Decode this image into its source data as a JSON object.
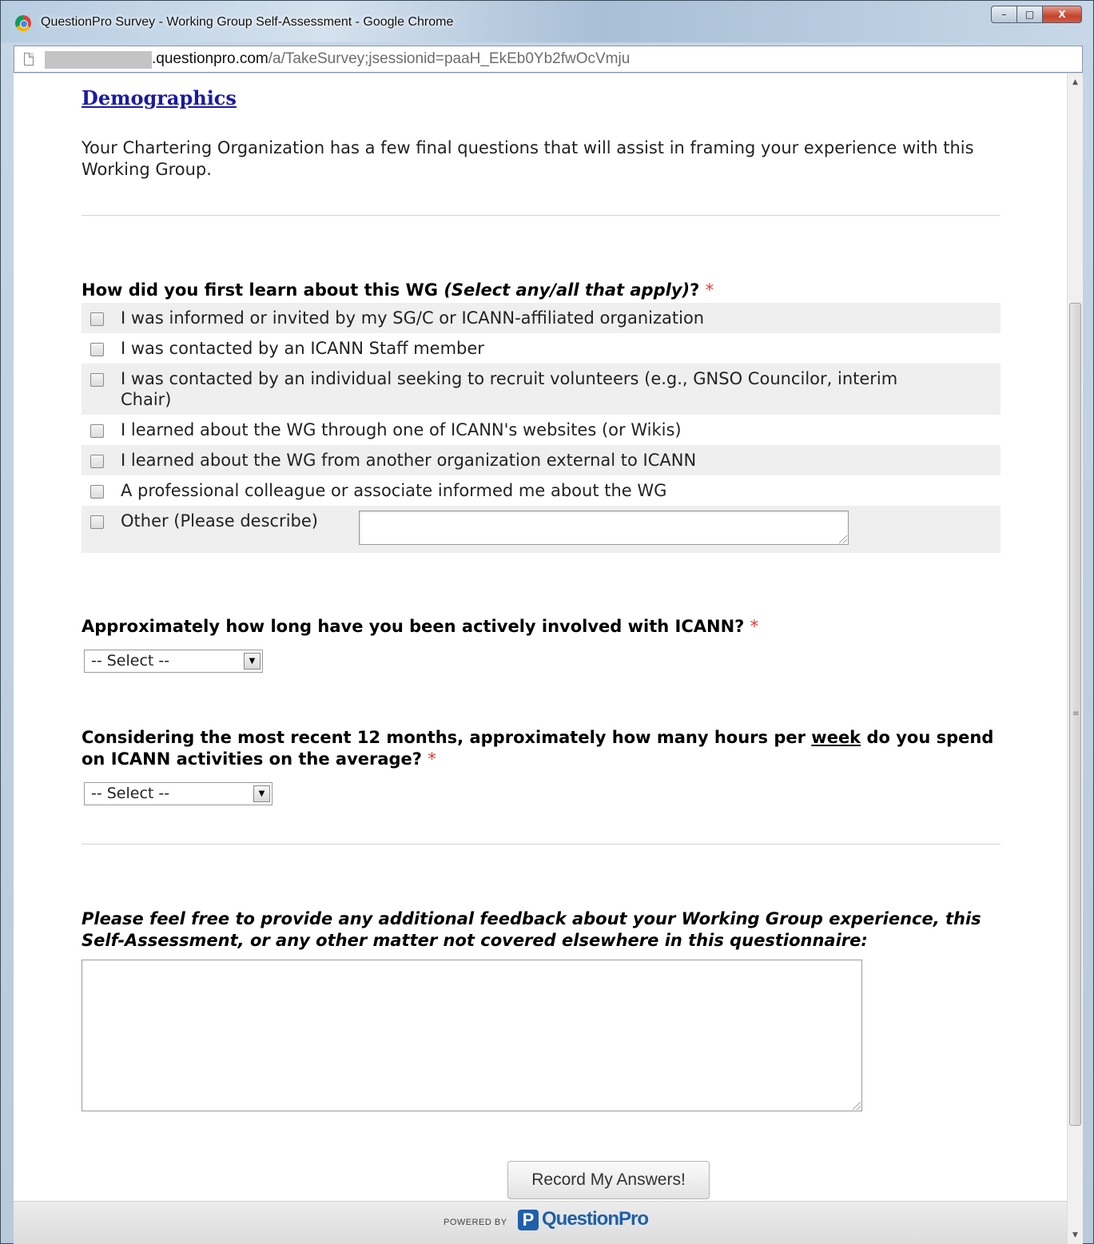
{
  "window": {
    "title": "QuestionPro Survey - Working Group Self-Assessment - Google Chrome",
    "controls": {
      "minimize": "–",
      "maximize": "□",
      "close": "X"
    }
  },
  "address": {
    "host_visible": ".questionpro.com",
    "path": "/a/TakeSurvey;jsessionid=paaH_EkEb0Yb2fwOcVmju"
  },
  "survey": {
    "section_title": "Demographics",
    "intro": "Your Chartering Organization has a few final questions that will assist in framing your experience with this Working Group.",
    "q1": {
      "title_start": "How did you first learn about this WG ",
      "title_italic": "(Select any/all that apply)",
      "title_end": "?",
      "required_mark": "*",
      "options": [
        "I was informed or invited by my SG/C or ICANN-affiliated organization",
        "I was contacted by an ICANN Staff member",
        "I was contacted by an individual seeking to recruit volunteers (e.g., GNSO Councilor, interim Chair)",
        "I learned about the WG through one of ICANN's websites (or Wikis)",
        "I learned about the WG from another organization external to ICANN",
        "A professional colleague or associate informed me about the WG",
        "Other (Please describe)"
      ]
    },
    "q2": {
      "title": "Approximately how long have you been actively involved with ICANN?",
      "required_mark": "*",
      "select_value": "-- Select --"
    },
    "q3": {
      "title_start": "Considering the most recent 12 months, approximately how many hours per ",
      "title_underlined": "week",
      "title_end": " do you spend on ICANN activities on the average?",
      "required_mark": "*",
      "select_value": "-- Select --"
    },
    "feedback": {
      "title": "Please feel free to provide any additional feedback about your Working Group experience, this Self-Assessment, or any other matter not covered elsewhere in this questionnaire:"
    },
    "submit_label": "Record My Answers!"
  },
  "footer": {
    "powered_by": "POWERED BY",
    "logo_letter": "P",
    "brand": "QuestionPro"
  },
  "colors": {
    "required": "#e03c31",
    "link": "#1a1aa6",
    "brand": "#1f5fa9"
  }
}
